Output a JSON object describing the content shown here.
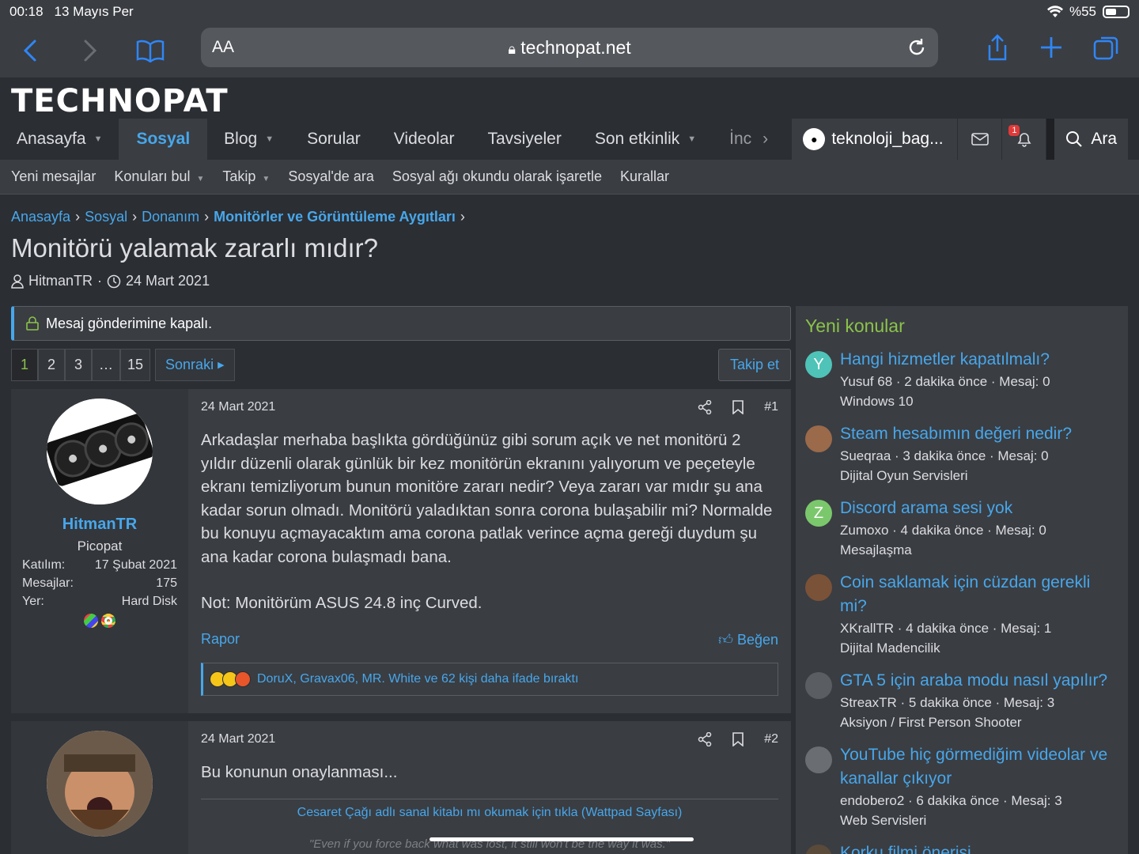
{
  "status": {
    "time": "00:18",
    "date": "13 Mayıs Per",
    "battery": "%55"
  },
  "browser": {
    "aa": "AA",
    "url": "technopat.net"
  },
  "site": {
    "logo": "TECHNOPAT"
  },
  "nav": {
    "tabs": [
      {
        "label": "Anasayfa"
      },
      {
        "label": "Sosyal"
      },
      {
        "label": "Blog"
      },
      {
        "label": "Sorular"
      },
      {
        "label": "Videolar"
      },
      {
        "label": "Tavsiyeler"
      },
      {
        "label": "Son etkinlik"
      },
      {
        "label": "İnc"
      }
    ],
    "user": "teknoloji_bag...",
    "alerts": "1",
    "search": "Ara"
  },
  "subnav": [
    "Yeni mesajlar",
    "Konuları bul",
    "Takip",
    "Sosyal'de ara",
    "Sosyal ağı okundu olarak işaretle",
    "Kurallar"
  ],
  "breadcrumb": [
    "Anasayfa",
    "Sosyal",
    "Donanım",
    "Monitörler ve Görüntüleme Aygıtları"
  ],
  "thread": {
    "title": "Monitörü yalamak zararlı mıdır?",
    "author": "HitmanTR",
    "date": "24 Mart 2021",
    "notice": "Mesaj gönderimine kapalı."
  },
  "pager": {
    "pages": [
      "1",
      "2",
      "3",
      "…",
      "15"
    ],
    "next": "Sonraki",
    "follow": "Takip et"
  },
  "posts": [
    {
      "date": "24 Mart 2021",
      "num": "#1",
      "user": "HitmanTR",
      "utitle": "Picopat",
      "stats": [
        {
          "k": "Katılım:",
          "v": "17 Şubat 2021"
        },
        {
          "k": "Mesajlar:",
          "v": "175"
        },
        {
          "k": "Yer:",
          "v": "Hard Disk"
        }
      ],
      "text": "Arkadaşlar merhaba başlıkta gördüğünüz gibi sorum açık ve net monitörü 2 yıldır düzenli olarak günlük bir kez monitörün ekranını yalıyorum ve peçeteyle ekranı temizliyorum bunun monitöre zararı nedir? Veya zararı var mıdır şu ana kadar sorun olmadı. Monitörü yaladıktan sonra corona bulaşabilir mi? Normalde bu konuyu açmayacaktım ama corona patlak verince açma gereği duydum şu ana kadar corona bulaşmadı bana.",
      "note": "Not: Monitörüm ASUS 24.8 inç Curved.",
      "report": "Rapor",
      "like": "Beğen",
      "reactions": "DoruX, Gravax06, MR. White ve 62 kişi daha ifade bıraktı"
    },
    {
      "date": "24 Mart 2021",
      "num": "#2",
      "text": "Bu konunun onaylanması...",
      "sig": "Cesaret Çağı adlı sanal kitabı mı okumak için tıkla (Wattpad Sayfası)",
      "sig2": "\"Even if you force back what was lost, it still won't be the way it was.\""
    }
  ],
  "sidebar": {
    "title": "Yeni konular",
    "threads": [
      {
        "title": "Hangi hizmetler kapatılmalı?",
        "meta": "Yusuf 68 · 2 dakika önce · Mesaj: 0",
        "forum": "Windows 10",
        "avatar": "Y",
        "color": "#4fc3b8"
      },
      {
        "title": "Steam hesabımın değeri nedir?",
        "meta": "Sueqraa · 3 dakika önce · Mesaj: 0",
        "forum": "Dijital Oyun Servisleri",
        "avatar": "",
        "color": "#9a6a4a"
      },
      {
        "title": "Discord arama sesi yok",
        "meta": "Zumoxo · 4 dakika önce · Mesaj: 0",
        "forum": "Mesajlaşma",
        "avatar": "Z",
        "color": "#7bc86c"
      },
      {
        "title": "Coin saklamak için cüzdan gerekli mi?",
        "meta": "XKrallTR · 4 dakika önce · Mesaj: 1",
        "forum": "Dijital Madencilik",
        "avatar": "",
        "color": "#7a5238"
      },
      {
        "title": "GTA 5 için araba modu nasıl yapılır?",
        "meta": "StreaxTR · 5 dakika önce · Mesaj: 3",
        "forum": "Aksiyon / First Person Shooter",
        "avatar": "",
        "color": "#5a5d62"
      },
      {
        "title": "YouTube hiç görmediğim videolar ve kanallar çıkıyor",
        "meta": "endobero2 · 6 dakika önce · Mesaj: 3",
        "forum": "Web Servisleri",
        "avatar": "",
        "color": "#6a6d72"
      },
      {
        "title": "Korku filmi önerisi",
        "meta": "",
        "forum": "",
        "avatar": "",
        "color": "#5a4a3a"
      }
    ]
  },
  "colors": {
    "accent": "#47a7eb",
    "green": "#8bc34a",
    "bg": "#2b2e33",
    "panel": "#3a3d42"
  }
}
